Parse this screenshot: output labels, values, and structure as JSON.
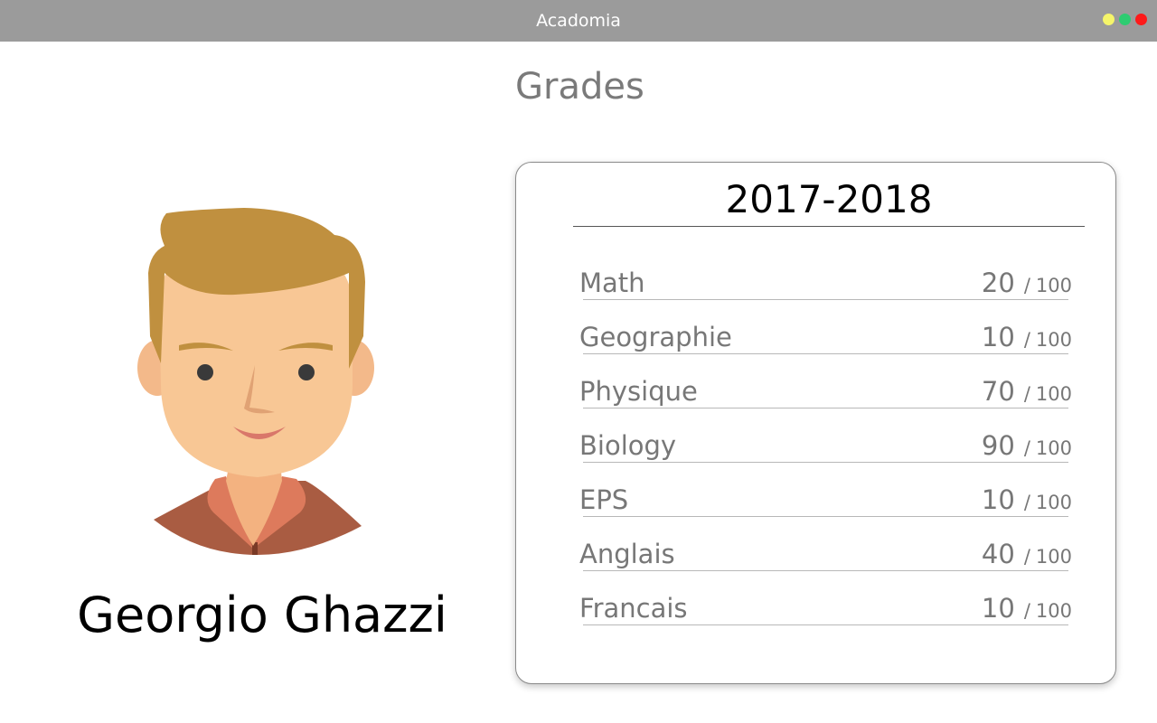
{
  "window": {
    "title": "Acadomia",
    "controls": {
      "minimize_color": "#f5f56a",
      "maximize_color": "#2ecc71",
      "close_color": "#ff1a1a"
    }
  },
  "page": {
    "title": "Grades"
  },
  "student": {
    "name": "Georgio Ghazzi",
    "avatar_icon": "student-avatar-illustration"
  },
  "grades": {
    "year": "2017-2018",
    "subjects": [
      {
        "name": "Math",
        "score": "20",
        "max": "100"
      },
      {
        "name": "Geographie",
        "score": "10",
        "max": "100"
      },
      {
        "name": "Physique",
        "score": "70",
        "max": "100"
      },
      {
        "name": "Biology",
        "score": "90",
        "max": "100"
      },
      {
        "name": "EPS",
        "score": "10",
        "max": "100"
      },
      {
        "name": "Anglais",
        "score": "40",
        "max": "100"
      },
      {
        "name": "Francais",
        "score": "10",
        "max": "100"
      }
    ],
    "separator": "/"
  }
}
